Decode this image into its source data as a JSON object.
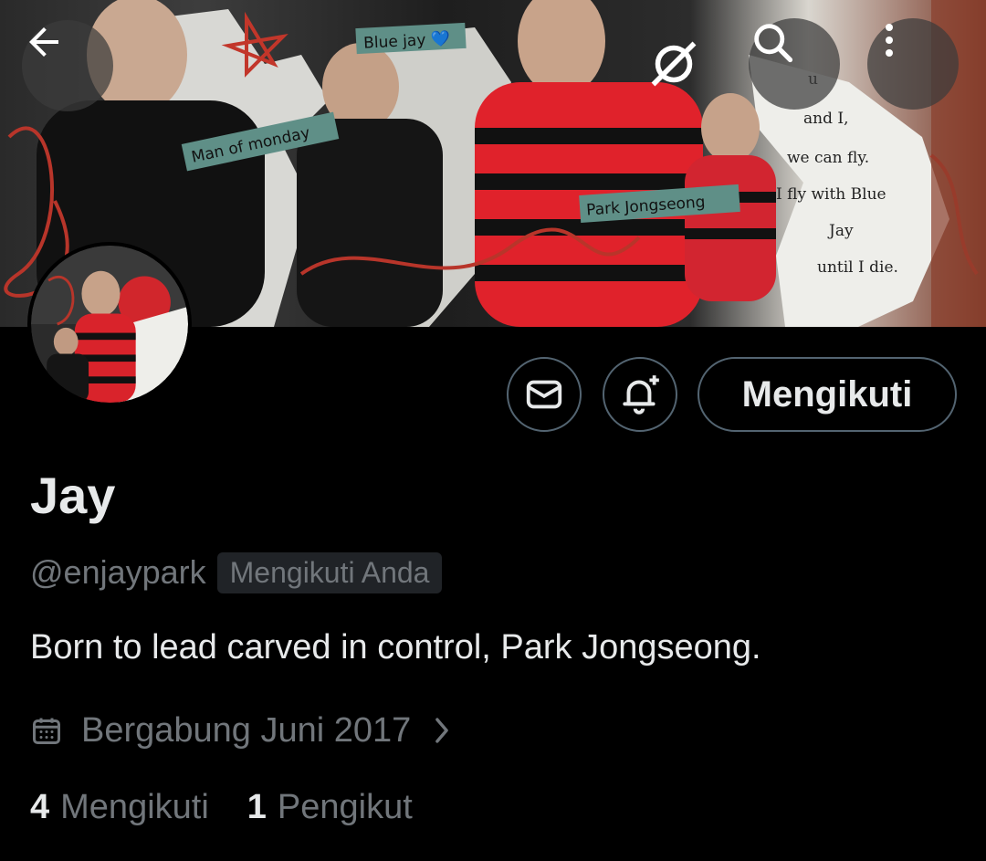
{
  "header": {
    "back_icon": "arrow-left-icon",
    "hidden_icon": "eye-slash-icon",
    "search_icon": "search-icon",
    "more_icon": "more-vertical-icon"
  },
  "banner": {
    "tag_1": "Blue jay 💙",
    "tag_2": "Man of monday",
    "tag_3": "Park Jongseong",
    "note_lines": [
      "u",
      "and I,",
      "we can fly.",
      "I fly with Blue",
      "Jay",
      "until I die."
    ]
  },
  "actions": {
    "message_icon": "envelope-icon",
    "notify_icon": "bell-plus-icon",
    "follow_label": "Mengikuti"
  },
  "profile": {
    "name": "Jay",
    "handle": "@enjaypark",
    "follows_you": "Mengikuti Anda",
    "bio": "Born to lead carved in control, Park Jongseong.",
    "joined": "Bergabung Juni 2017",
    "joined_icon": "calendar-icon"
  },
  "stats": {
    "following_count": "4",
    "following_label": "Mengikuti",
    "followers_count": "1",
    "followers_label": "Pengikut"
  },
  "colors": {
    "background": "#000000",
    "text_primary": "#e7e9ea",
    "text_secondary": "#71767b",
    "border": "#536471",
    "accent_red": "#e0222b"
  }
}
